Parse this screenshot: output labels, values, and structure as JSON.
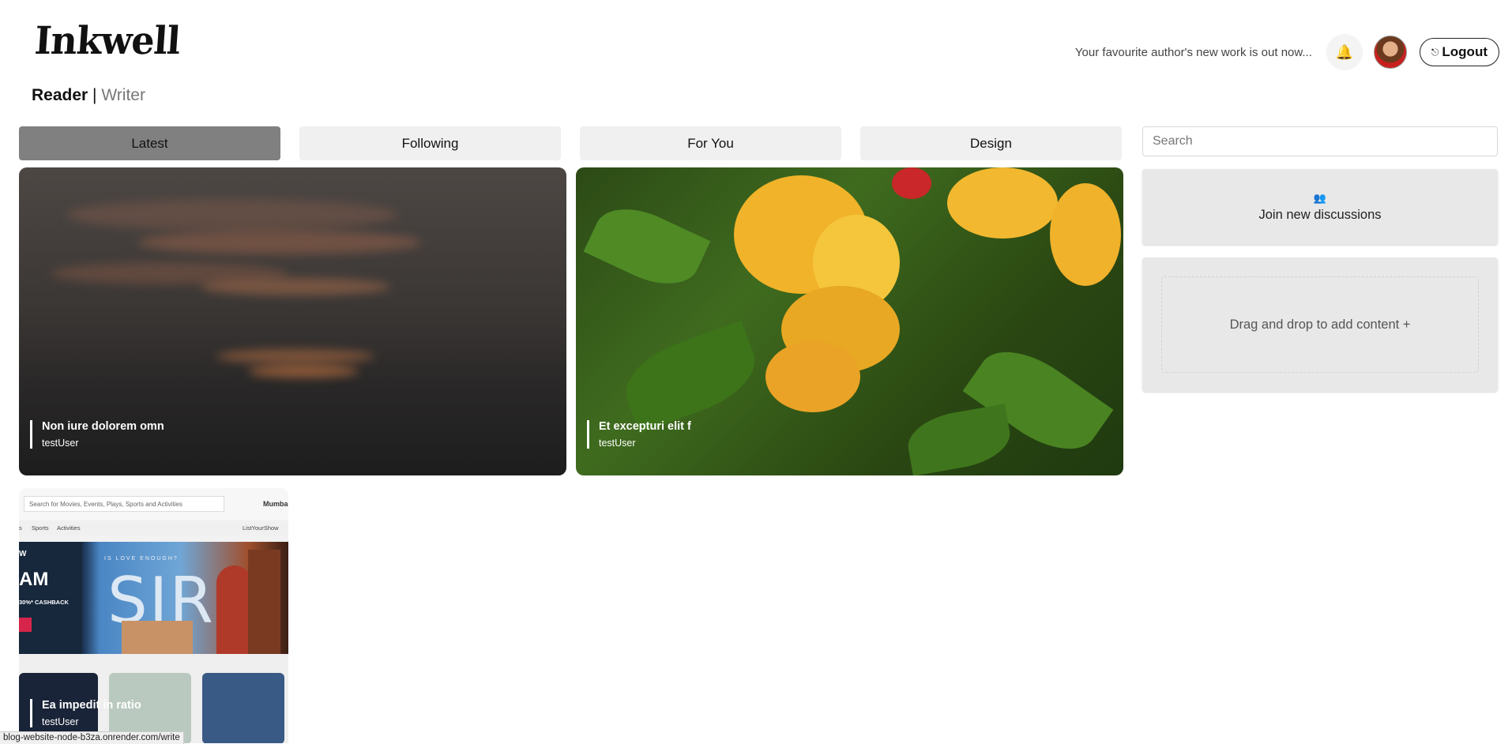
{
  "brand": {
    "logo_text": "Inkwell"
  },
  "header": {
    "tagline": "Your favourite author's new work is out now...",
    "bell_icon": "🔔",
    "logout_icon": "⎋",
    "logout_label": "Logout"
  },
  "mode_switch": {
    "active": "Reader",
    "separator": "|",
    "inactive": "Writer"
  },
  "tabs": [
    {
      "label": "Latest",
      "selected": true
    },
    {
      "label": "Following",
      "selected": false
    },
    {
      "label": "For You",
      "selected": false
    },
    {
      "label": "Design",
      "selected": false
    }
  ],
  "posts": [
    {
      "title": "Non iure dolorem omn",
      "author": "testUser"
    },
    {
      "title": "Et excepturi elit f",
      "author": "testUser"
    },
    {
      "title": "Ea impedit in ratio",
      "author": "testUser"
    }
  ],
  "post3_preview": {
    "search_placeholder": "Search for Movies, Events, Plays, Sports and Activities",
    "city": "Mumbai",
    "nav_sports": "Sports",
    "nav_activities": "Activities",
    "nav_listyourshow": "ListYourShow",
    "nav_left_fragment": "s",
    "banner_love": "IS LOVE ENOUGH?",
    "banner_title": "SIR",
    "banner_left_top": "W",
    "banner_left_big": "AM",
    "banner_cashback": "30%* CASHBACK"
  },
  "sidebar": {
    "search_placeholder": "Search",
    "join_icon": "👥",
    "join_label": "Join new discussions",
    "dropzone_label": "Drag and drop to add content +"
  },
  "status_bar": {
    "url": "blog-website-node-b3za.onrender.com/write"
  }
}
